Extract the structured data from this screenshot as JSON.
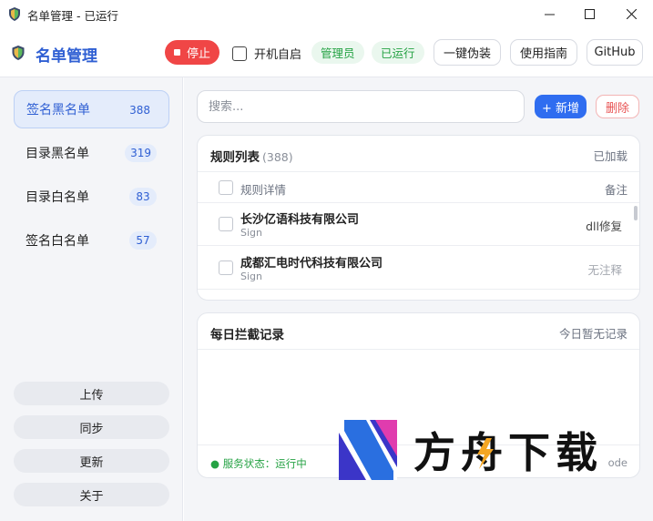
{
  "window": {
    "title": "名单管理 - 已运行",
    "min_icon": "minimize-icon",
    "max_icon": "maximize-icon",
    "close_icon": "close-icon"
  },
  "toolbar": {
    "brand": "名单管理",
    "stop_label": "停止",
    "autostart_label": "开机自启",
    "autostart_checked": false,
    "admin_badge": "管理员",
    "running_badge": "已运行",
    "disguise_label": "一键伪装",
    "guide_label": "使用指南",
    "github_label": "GitHub"
  },
  "sidebar": {
    "items": [
      {
        "label": "签名黑名单",
        "count": "388",
        "active": true
      },
      {
        "label": "目录黑名单",
        "count": "319",
        "active": false
      },
      {
        "label": "目录白名单",
        "count": "83",
        "active": false
      },
      {
        "label": "签名白名单",
        "count": "57",
        "active": false
      }
    ],
    "actions": {
      "upload": "上传",
      "sync": "同步",
      "update": "更新",
      "about": "关于"
    }
  },
  "main": {
    "search_placeholder": "搜索...",
    "add_label": "+ 新增",
    "delete_label": "删除",
    "rules": {
      "title": "规则列表",
      "count": "(388)",
      "status": "已加载",
      "col_detail": "规则详情",
      "col_note": "备注",
      "rows": [
        {
          "name": "长沙亿语科技有限公司",
          "type": "Sign",
          "note": "dll修复"
        },
        {
          "name": "成都汇电时代科技有限公司",
          "type": "Sign",
          "note": "无注释"
        }
      ]
    },
    "log": {
      "title": "每日拦截记录",
      "status": "今日暂无记录",
      "service_status": "● 服务状态：运行中",
      "footer_right": "ode"
    }
  },
  "watermark": {
    "text": "方舟下载"
  },
  "colors": {
    "accent": "#2f5fd3",
    "primary_button": "#2f6df0",
    "stop_button": "#f04646",
    "success": "#25a244",
    "danger": "#e85454"
  }
}
